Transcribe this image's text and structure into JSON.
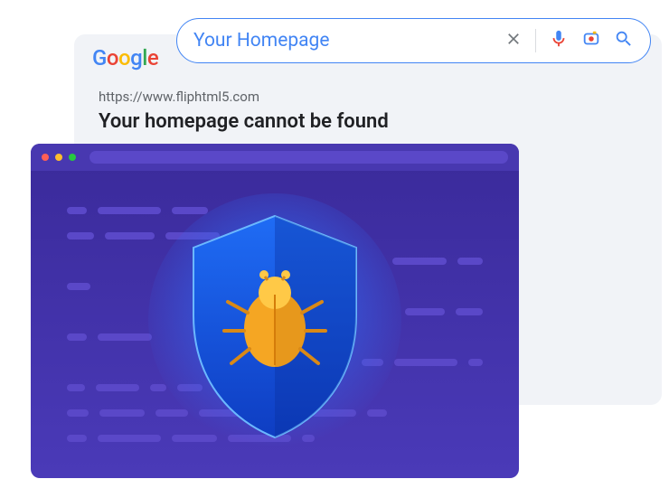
{
  "search": {
    "query": "Your Homepage",
    "logo": "Google"
  },
  "result": {
    "url": "https://www.fliphtml5.com",
    "title": "Your homepage cannot be found"
  },
  "icons": {
    "clear": "clear-icon",
    "voice": "voice-icon",
    "lens": "lens-icon",
    "search": "search-icon",
    "shield": "shield-icon",
    "bug": "bug-icon"
  },
  "colors": {
    "blue": "#4285f4",
    "red": "#ea4335",
    "yellow": "#fbbc05",
    "green": "#34a853",
    "shieldBg": "#3a2a9a",
    "bugOrange": "#f5a623"
  }
}
